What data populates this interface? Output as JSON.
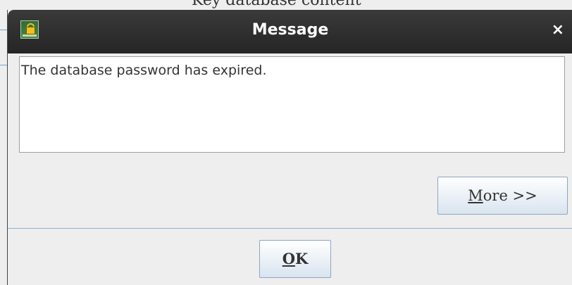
{
  "background": {
    "title": "Key database content"
  },
  "dialog": {
    "title": "Message",
    "close_symbol": "×",
    "app_icon": "keyring-lock-icon",
    "message": "The database password has expired.",
    "more_button": {
      "mnemonic": "M",
      "rest": "ore >>"
    },
    "ok_button": {
      "mnemonic": "O",
      "rest": "K"
    }
  },
  "colors": {
    "titlebar": "#2e2e2e",
    "button_gradient_end": "#d9e4f0",
    "divider": "#8fb0d0"
  }
}
